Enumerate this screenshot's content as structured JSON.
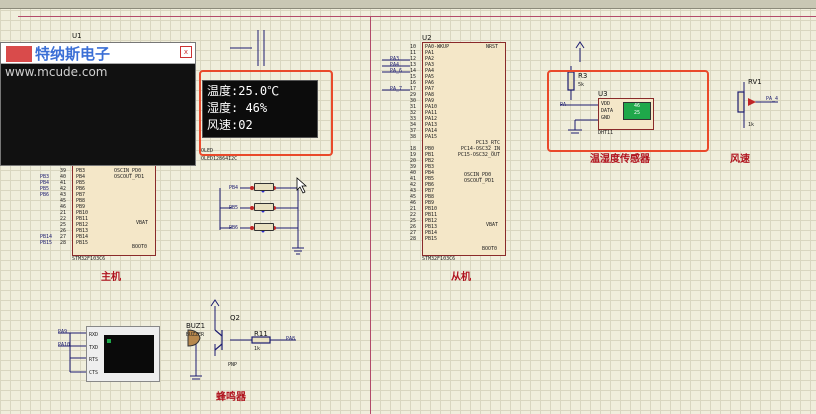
{
  "window": {
    "watermark_brand": "特纳斯电子",
    "watermark_url": "www.mcude.com",
    "close_label": "x"
  },
  "master": {
    "ref": "U1",
    "part": "STM32F103C6",
    "section_label": "主机",
    "pins_left": [
      "PB3",
      "PB4",
      "PB5",
      "PB6",
      "PB7",
      "PB8",
      "PB9",
      "PB10",
      "PB11",
      "PB12",
      "PB13",
      "PB14",
      "PB15"
    ],
    "pin_numbers_left": [
      "39",
      "40",
      "41",
      "42",
      "43",
      "45",
      "46",
      "21",
      "22",
      "25",
      "26",
      "27",
      "28"
    ],
    "osc": [
      "OSCIN_PD0",
      "OSCOUT_PD1"
    ],
    "vbat": "VBAT",
    "boot0": "BOOT0",
    "nets_left": [
      "PB3",
      "PB4",
      "PB5",
      "PB6",
      "PB14",
      "PB15"
    ]
  },
  "slave": {
    "ref": "U2",
    "part": "STM32F103C6",
    "section_label": "从机",
    "pins_left": [
      "PA0-WKUP",
      "PA1",
      "PA2",
      "PA3",
      "PA4",
      "PA5",
      "PA6",
      "PA7",
      "PA8",
      "PA9",
      "PA10",
      "PA11",
      "PA12",
      "PA13",
      "PA14",
      "PA15",
      "",
      "PB0",
      "PB1",
      "PB2",
      "PB3",
      "PB4",
      "PB5",
      "PB6",
      "PB7",
      "PB8",
      "PB9",
      "PB10",
      "PB11",
      "PB12",
      "PB13",
      "PB14",
      "PB15"
    ],
    "pin_numbers_left": [
      "10",
      "11",
      "12",
      "13",
      "14",
      "15",
      "16",
      "17",
      "29",
      "30",
      "31",
      "32",
      "33",
      "34",
      "37",
      "38",
      "",
      "18",
      "19",
      "20",
      "39",
      "40",
      "41",
      "42",
      "43",
      "45",
      "46",
      "21",
      "22",
      "25",
      "26",
      "27",
      "28"
    ],
    "nrst": "NRST",
    "pc": [
      "PC13_RTC",
      "PC14-OSC32_IN",
      "PC15-OSC32_OUT"
    ],
    "osc": [
      "OSCIN_PD0",
      "OSCOUT_PD1"
    ],
    "vbat": "VBAT",
    "boot0": "BOOT0",
    "nets_left": [
      "PA3",
      "PA4",
      "PA_6",
      "PA_7"
    ]
  },
  "oled": {
    "ref": "OLED",
    "part": "OLED12864I2C",
    "lines": [
      "温度:25.0℃",
      "湿度: 46%",
      "风速:02"
    ]
  },
  "sensor": {
    "ref_r": "R3",
    "r_value": "5k",
    "ref": "U3",
    "part": "DHT11",
    "pins": [
      "VDD",
      "DATA",
      "GND"
    ],
    "net": "PA",
    "display_top": "46",
    "display_bottom": "25",
    "section_label": "温湿度传感器"
  },
  "fan": {
    "ref": "RV1",
    "net": "PA_4",
    "value": "1k",
    "section_label": "风速"
  },
  "buttons": {
    "nets": [
      "PB4",
      "PB5",
      "PB6"
    ]
  },
  "uart": {
    "pins": [
      "RXD",
      "TXD",
      "RTS",
      "CTS"
    ],
    "nets": [
      "PA9",
      "PA10"
    ]
  },
  "buzzer": {
    "ref": "BUZ1",
    "part": "BUZZER",
    "transistor_ref": "Q2",
    "transistor_part": "PNP",
    "resistor_ref": "R11",
    "resistor_value": "1k",
    "net": "PA8",
    "section_label": "蜂鸣器"
  },
  "colors": {
    "sheet_bg": "#f0eedc",
    "grid": "#d9d6c0",
    "highlight": "#e9492b",
    "chip_fill": "#f4e7c8",
    "chip_border": "#8a2a2a",
    "label_red": "#b0131e",
    "wire": "#1b1b70",
    "sensor_lcd": "#1fa84a"
  }
}
